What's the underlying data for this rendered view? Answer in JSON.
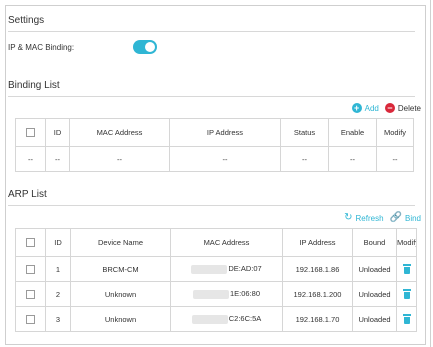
{
  "settings": {
    "title": "Settings",
    "binding_label": "IP & MAC Binding:",
    "binding_enabled": true
  },
  "binding_list": {
    "title": "Binding List",
    "add_label": "Add",
    "delete_label": "Delete",
    "headers": [
      "ID",
      "MAC Address",
      "IP Address",
      "Status",
      "Enable",
      "Modify"
    ],
    "empty_row": [
      "--",
      "--",
      "--",
      "--",
      "--",
      "--",
      "--"
    ]
  },
  "arp_list": {
    "title": "ARP List",
    "refresh_label": "Refresh",
    "bind_label": "Bind",
    "headers": [
      "ID",
      "Device Name",
      "MAC Address",
      "IP Address",
      "Bound",
      "Modify"
    ],
    "rows": [
      {
        "id": "1",
        "device": "BRCM-CM",
        "mac": "DE:AD:07",
        "ip": "192.168.1.86",
        "bound": "Unloaded"
      },
      {
        "id": "2",
        "device": "Unknown",
        "mac": "1E:06:80",
        "ip": "192.168.1.200",
        "bound": "Unloaded"
      },
      {
        "id": "3",
        "device": "Unknown",
        "mac": "C2:6C:5A",
        "ip": "192.168.1.70",
        "bound": "Unloaded"
      }
    ]
  },
  "colors": {
    "accent": "#2fb6d4",
    "danger": "#d9283a"
  }
}
